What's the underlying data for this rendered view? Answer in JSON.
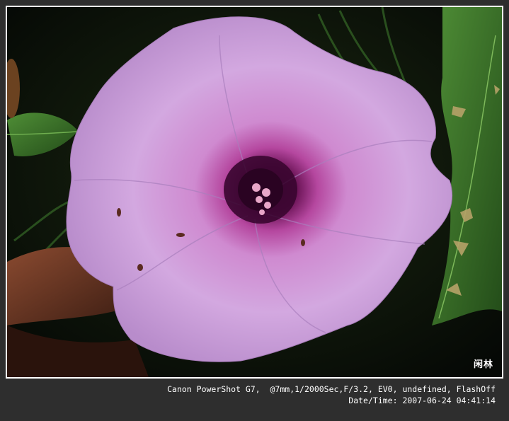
{
  "photo": {
    "subject_icon": "morning-glory-flower",
    "signature": "闲林"
  },
  "exif": {
    "line1": "Canon PowerShot G7,  @7mm,1/2000Sec,F/3.2, EV0, undefined, FlashOff",
    "line2": "Date/Time: 2007-06-24 04:41:14"
  },
  "colors": {
    "frame": "#2e2e2e",
    "border": "#ffffff",
    "petal": "#c99ad6",
    "throat": "#4a0a3a",
    "leaf": "#3f7a2c"
  }
}
